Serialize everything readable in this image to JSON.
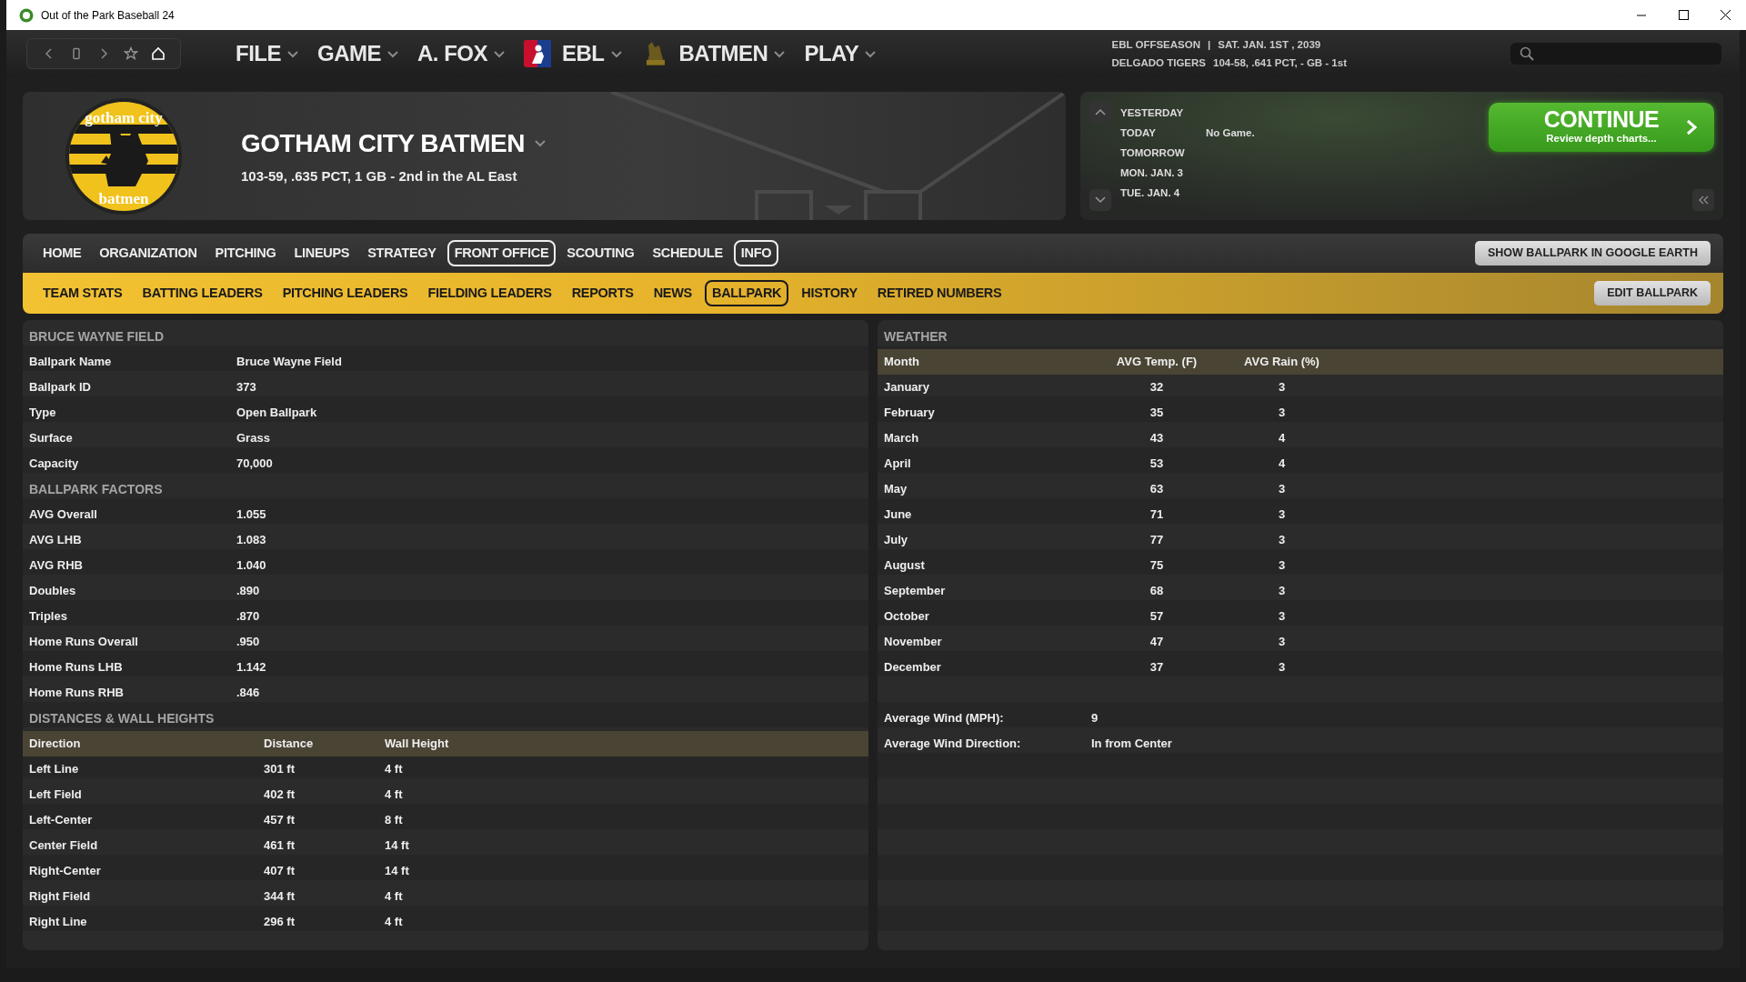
{
  "window": {
    "title": "Out of the Park Baseball 24"
  },
  "menus": [
    {
      "label": "FILE",
      "kind": "plain"
    },
    {
      "label": "GAME",
      "kind": "plain"
    },
    {
      "label": "A. FOX",
      "kind": "plain"
    },
    {
      "label": "EBL",
      "kind": "league"
    },
    {
      "label": "BATMEN",
      "kind": "team"
    },
    {
      "label": "PLAY",
      "kind": "plain"
    }
  ],
  "status": {
    "league": "EBL OFFSEASON",
    "separator": "|",
    "date": "SAT. JAN. 1ST , 2039",
    "leader": "DELGADO TIGERS",
    "leader_record": "104-58, .641 PCT, - GB - 1st"
  },
  "team": {
    "logo_top": "gotham city",
    "logo_bottom": "batmen",
    "name": "GOTHAM CITY BATMEN",
    "record": "103-59, .635 PCT, 1 GB - 2nd in the AL East"
  },
  "schedule": {
    "days": [
      {
        "label": "YESTERDAY"
      },
      {
        "label": "TODAY",
        "game": "No Game."
      },
      {
        "label": "TOMORROW"
      },
      {
        "label": "MON. JAN. 3"
      },
      {
        "label": "TUE. JAN. 4"
      }
    ],
    "continue": {
      "label": "CONTINUE",
      "sub": "Review depth charts..."
    }
  },
  "nav": {
    "items": [
      {
        "label": "HOME",
        "selected": false
      },
      {
        "label": "ORGANIZATION",
        "selected": false
      },
      {
        "label": "PITCHING",
        "selected": false
      },
      {
        "label": "LINEUPS",
        "selected": false
      },
      {
        "label": "STRATEGY",
        "selected": false
      },
      {
        "label": "FRONT OFFICE",
        "selected": true
      },
      {
        "label": "SCOUTING",
        "selected": false
      },
      {
        "label": "SCHEDULE",
        "selected": false
      },
      {
        "label": "INFO",
        "selected": true
      }
    ],
    "action": "SHOW BALLPARK IN GOOGLE EARTH"
  },
  "subnav": {
    "items": [
      {
        "label": "TEAM STATS",
        "selected": false
      },
      {
        "label": "BATTING LEADERS",
        "selected": false
      },
      {
        "label": "PITCHING LEADERS",
        "selected": false
      },
      {
        "label": "FIELDING LEADERS",
        "selected": false
      },
      {
        "label": "REPORTS",
        "selected": false
      },
      {
        "label": "NEWS",
        "selected": false
      },
      {
        "label": "BALLPARK",
        "selected": true
      },
      {
        "label": "HISTORY",
        "selected": false
      },
      {
        "label": "RETIRED NUMBERS",
        "selected": false
      }
    ],
    "action": "EDIT BALLPARK"
  },
  "ballpark": {
    "title": "BRUCE WAYNE FIELD",
    "rows": [
      [
        "Ballpark Name",
        "Bruce Wayne Field"
      ],
      [
        "Ballpark ID",
        "373"
      ],
      [
        "Type",
        "Open Ballpark"
      ],
      [
        "Surface",
        "Grass"
      ],
      [
        "Capacity",
        "70,000"
      ]
    ]
  },
  "factors": {
    "title": "BALLPARK FACTORS",
    "rows": [
      [
        "AVG Overall",
        "1.055"
      ],
      [
        "AVG LHB",
        "1.083"
      ],
      [
        "AVG RHB",
        "1.040"
      ],
      [
        "Doubles",
        ".890"
      ],
      [
        "Triples",
        ".870"
      ],
      [
        "Home Runs Overall",
        ".950"
      ],
      [
        "Home Runs LHB",
        "1.142"
      ],
      [
        "Home Runs RHB",
        ".846"
      ]
    ]
  },
  "distances": {
    "title": "DISTANCES & WALL HEIGHTS",
    "columns": [
      "Direction",
      "Distance",
      "Wall Height"
    ],
    "rows": [
      [
        "Left Line",
        "301 ft",
        "4 ft"
      ],
      [
        "Left Field",
        "402 ft",
        "4 ft"
      ],
      [
        "Left-Center",
        "457 ft",
        "8 ft"
      ],
      [
        "Center Field",
        "461 ft",
        "14 ft"
      ],
      [
        "Right-Center",
        "407 ft",
        "14 ft"
      ],
      [
        "Right Field",
        "344 ft",
        "4 ft"
      ],
      [
        "Right Line",
        "296 ft",
        "4 ft"
      ]
    ]
  },
  "weather": {
    "title": "WEATHER",
    "columns": [
      "Month",
      "AVG Temp. (F)",
      "AVG Rain (%)"
    ],
    "rows": [
      [
        "January",
        "32",
        "3"
      ],
      [
        "February",
        "35",
        "3"
      ],
      [
        "March",
        "43",
        "4"
      ],
      [
        "April",
        "53",
        "4"
      ],
      [
        "May",
        "63",
        "3"
      ],
      [
        "June",
        "71",
        "3"
      ],
      [
        "July",
        "77",
        "3"
      ],
      [
        "August",
        "75",
        "3"
      ],
      [
        "September",
        "68",
        "3"
      ],
      [
        "October",
        "57",
        "3"
      ],
      [
        "November",
        "47",
        "3"
      ],
      [
        "December",
        "37",
        "3"
      ]
    ],
    "wind": [
      [
        "Average Wind (MPH):",
        "9"
      ],
      [
        "Average Wind Direction:",
        "In from Center"
      ]
    ]
  }
}
